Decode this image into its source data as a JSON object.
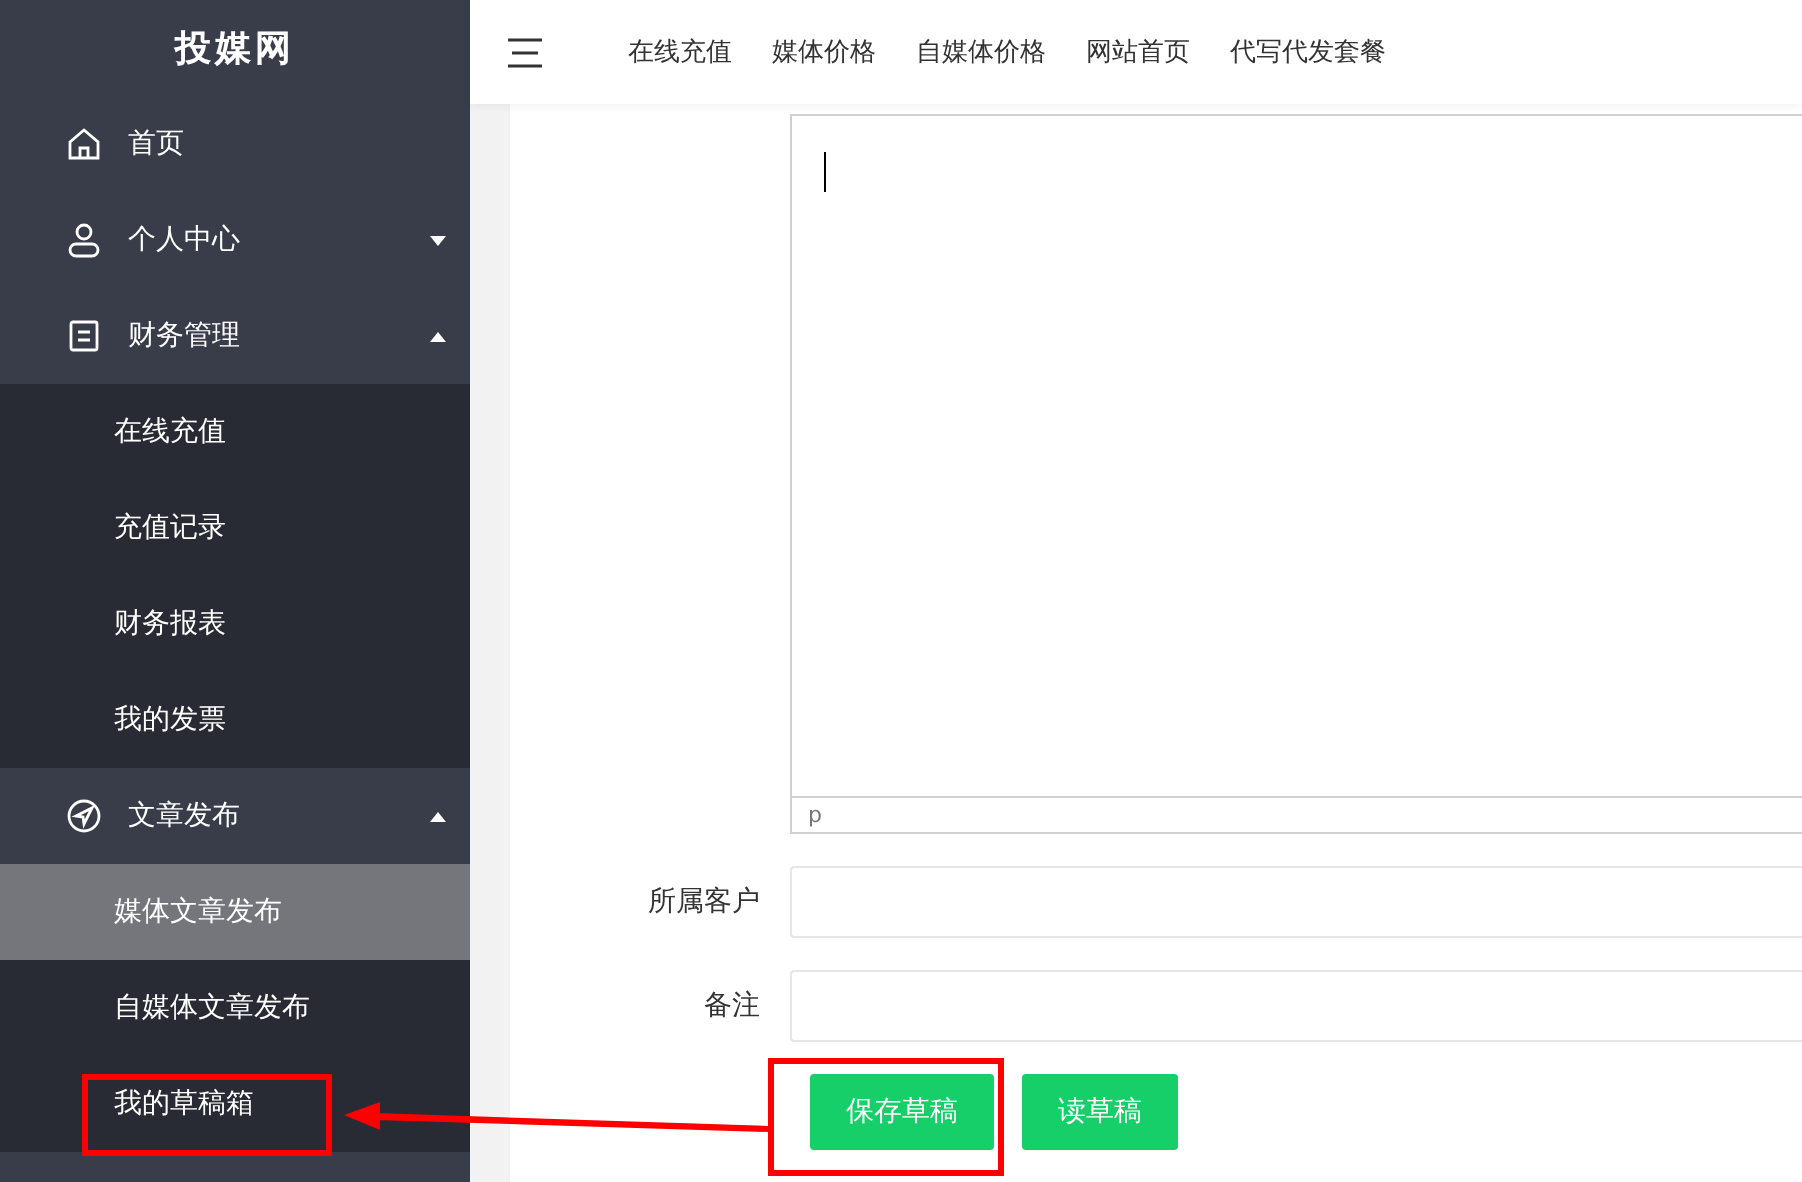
{
  "sidebar": {
    "logo": "投媒网",
    "items": [
      {
        "label": "首页",
        "selected": false
      },
      {
        "label": "个人中心",
        "expanded": false,
        "selected": false
      },
      {
        "label": "财务管理",
        "expanded": true,
        "selected": false,
        "children": [
          {
            "label": "在线充值",
            "selected": false
          },
          {
            "label": "充值记录",
            "selected": false
          },
          {
            "label": "财务报表",
            "selected": false
          },
          {
            "label": "我的发票",
            "selected": false
          }
        ]
      },
      {
        "label": "文章发布",
        "expanded": true,
        "selected": false,
        "children": [
          {
            "label": "媒体文章发布",
            "selected": true
          },
          {
            "label": "自媒体文章发布",
            "selected": false
          },
          {
            "label": "我的草稿箱",
            "selected": false
          }
        ]
      }
    ]
  },
  "header": {
    "nav": [
      "在线充值",
      "媒体价格",
      "自媒体价格",
      "网站首页",
      "代写代发套餐"
    ]
  },
  "editor": {
    "path": "p"
  },
  "form": {
    "fields": [
      {
        "label": "所属客户"
      },
      {
        "label": "备注"
      }
    ],
    "buttons": [
      "保存草稿",
      "读草稿"
    ]
  }
}
